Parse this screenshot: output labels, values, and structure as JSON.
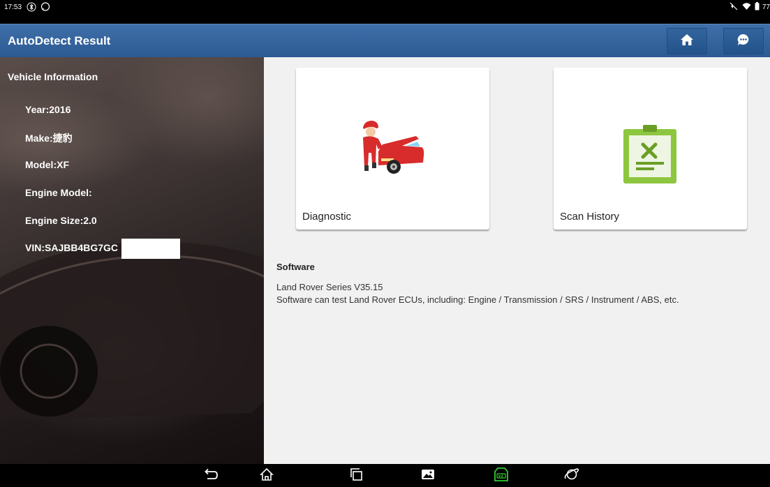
{
  "status_bar": {
    "time": "17:53",
    "battery": "77"
  },
  "header": {
    "title": "AutoDetect Result",
    "home_icon": "home-icon",
    "chat_icon": "chat-icon"
  },
  "vehicle_info": {
    "heading": "Vehicle Information",
    "year": "Year:2016",
    "make": "Make:捷豹",
    "model": "Model:XF",
    "engine_model": "Engine Model:",
    "engine_size": "Engine Size:2.0",
    "vin": "VIN:SAJBB4BG7GC"
  },
  "cards": {
    "diagnostic": "Diagnostic",
    "scan_history": "Scan History"
  },
  "software": {
    "heading": "Software",
    "line1": "Land Rover Series V35.15",
    "line2": "Software can test Land Rover ECUs, including: Engine / Transmission / SRS / Instrument  / ABS, etc."
  },
  "colors": {
    "title_bar": "#2c5a93",
    "vci_green": "#33cc33",
    "clipboard_green": "#8dc63f"
  }
}
